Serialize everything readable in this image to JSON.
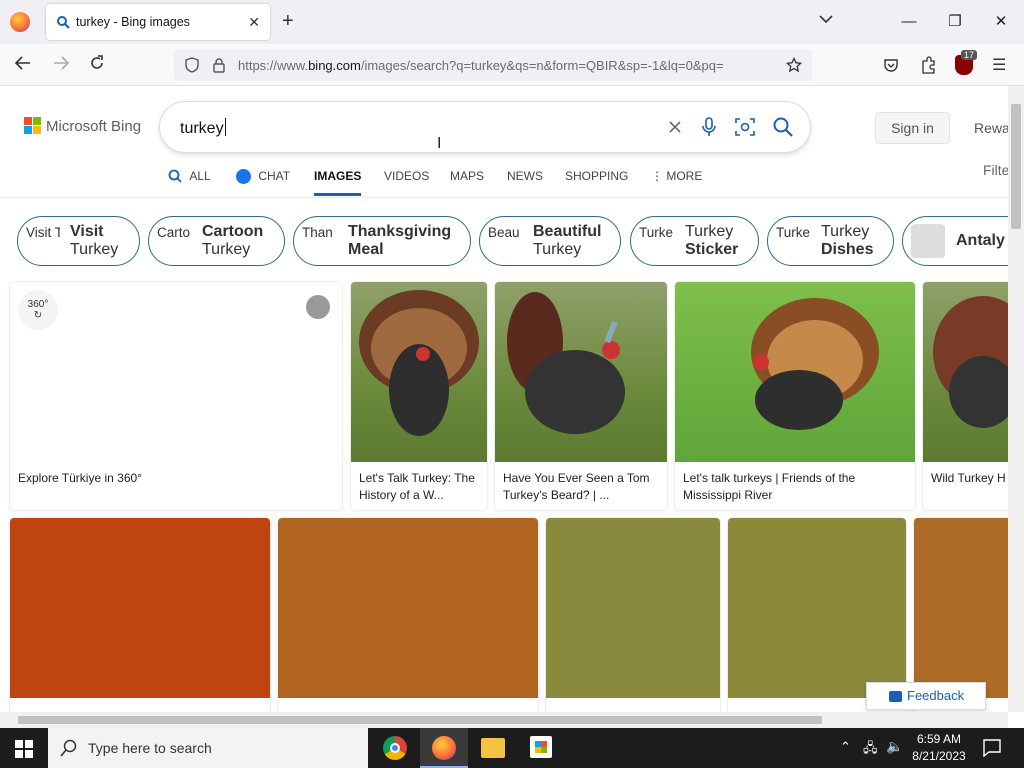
{
  "browser": {
    "tab_title": "turkey - Bing images",
    "new_tab": "+",
    "url_prefix": "https://www.",
    "url_domain": "bing.com",
    "url_rest": "/images/search?q=turkey&qs=n&form=QBIR&sp=-1&lq=0&pq=",
    "extension_badge": "17"
  },
  "bing": {
    "logo_text": "Microsoft Bing",
    "query": "turkey",
    "sign_in": "Sign in",
    "rewards": "Rewa",
    "filter": "Filte",
    "tabs": [
      "ALL",
      "CHAT",
      "IMAGES",
      "VIDEOS",
      "MAPS",
      "NEWS",
      "SHOPPING",
      "MORE"
    ],
    "active_tab": "IMAGES",
    "chips": [
      {
        "thumb": "Visit Turke",
        "bold": "Visit",
        "rest": "Turkey"
      },
      {
        "thumb": "Carto Turke",
        "bold": "Cartoon",
        "rest": "Turkey"
      },
      {
        "thumb": "Than Meal",
        "bold": "Thanksgiving Meal",
        "rest": ""
      },
      {
        "thumb": "Beau Turke",
        "bold": "Beautiful",
        "rest": "Turkey"
      },
      {
        "thumb": "Turke Sticke",
        "bold": "Sticker",
        "rest": "Turkey"
      },
      {
        "thumb": "Turke Dishe",
        "bold": "Dishes",
        "rest": "Turkey"
      },
      {
        "thumb": "",
        "bold": "Antaly",
        "rest": ""
      }
    ],
    "images_row1": [
      {
        "caption": "Explore Türkiye in 360°",
        "badge": "360°"
      },
      {
        "caption": "Let's Talk Turkey: The History of a W..."
      },
      {
        "caption": "Have You Ever Seen a Tom Turkey's Beard? | ..."
      },
      {
        "caption": "Let's talk turkeys | Friends of the Mississippi River"
      },
      {
        "caption": "Wild Turkey H"
      }
    ],
    "row2_colors": [
      "#bf4410",
      "#b0641f",
      "#8a8a3e",
      "#8b8a3b",
      "#ad6b28"
    ],
    "feedback": "Feedback"
  },
  "taskbar": {
    "search_placeholder": "Type here to search",
    "time": "6:59 AM",
    "date": "8/21/2023"
  }
}
